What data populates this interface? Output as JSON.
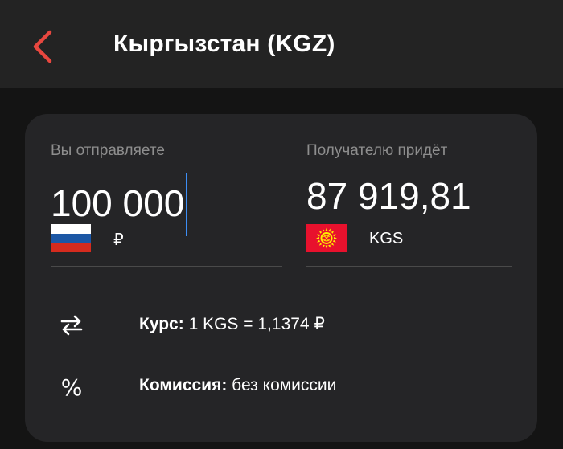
{
  "header": {
    "title": "Кыргызстан (KGZ)",
    "back_icon": "chevron-left-icon",
    "accent_color": "#e8473f"
  },
  "send": {
    "label": "Вы отправляете",
    "amount": "100 000",
    "currency": "₽",
    "flag": "russia-flag"
  },
  "receive": {
    "label": "Получателю придёт",
    "amount": "87 919,81",
    "currency": "KGS",
    "flag": "kyrgyzstan-flag"
  },
  "rate": {
    "icon": "swap-arrows-icon",
    "label": "Курс:",
    "value": "1 KGS = 1,1374 ₽"
  },
  "commission": {
    "icon": "percent-icon",
    "label": "Комиссия:",
    "value": "без комиссии"
  }
}
